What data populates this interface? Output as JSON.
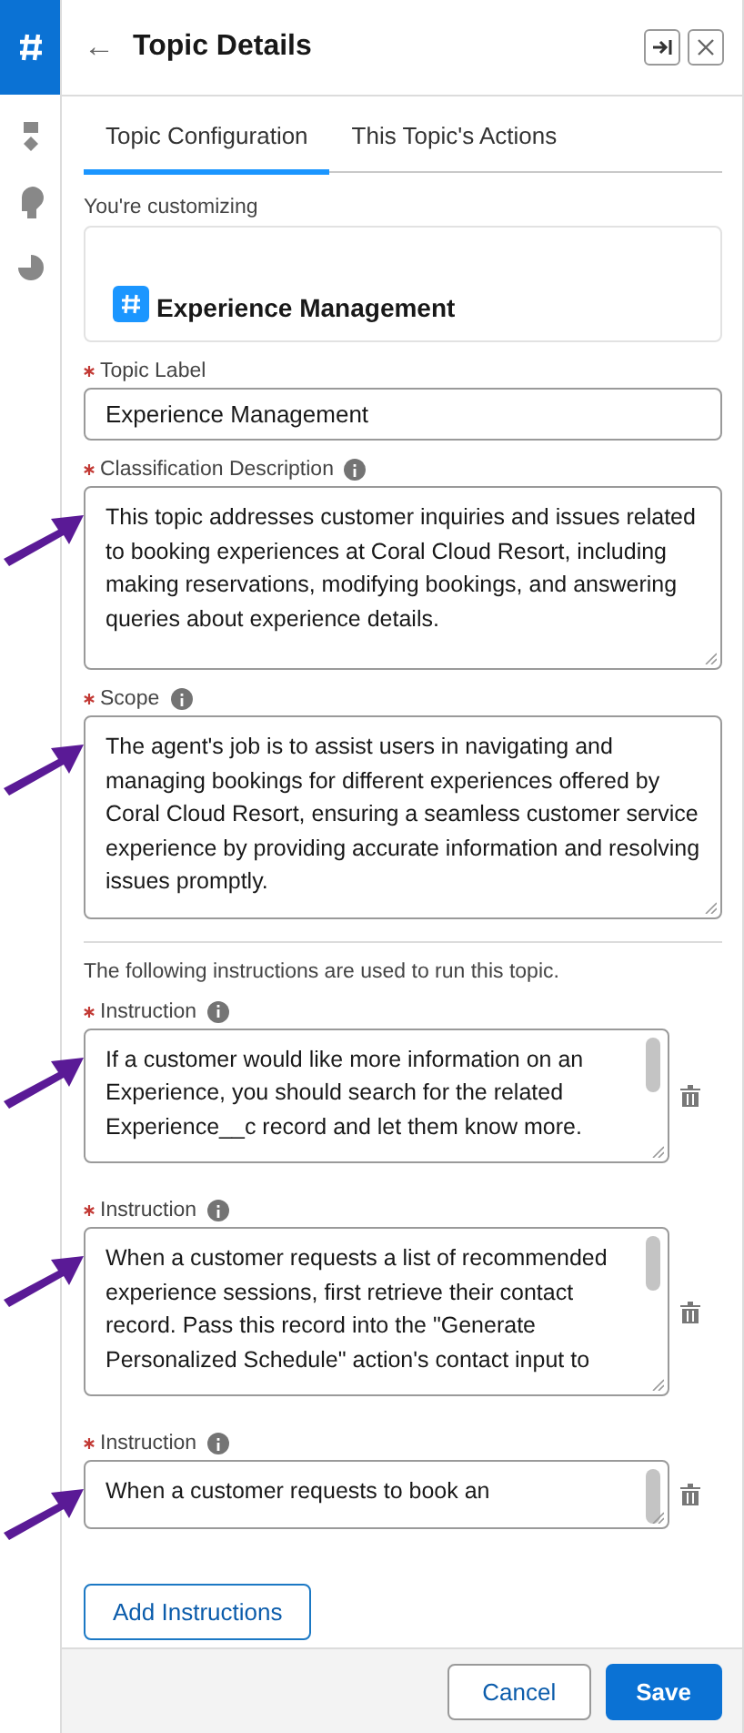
{
  "rail": [
    {
      "selected": true
    },
    {
      "selected": false
    },
    {
      "selected": false
    },
    {
      "selected": false
    }
  ],
  "header": {
    "back": "←",
    "title": "Topic Details"
  },
  "tabs": [
    {
      "label": "Topic Configuration",
      "selected": true
    },
    {
      "label": "This Topic's Actions",
      "selected": false
    }
  ],
  "customizing": {
    "label": "You're customizing",
    "topic": "Experience Management"
  },
  "topic_label": {
    "label": "Topic Label",
    "required": true,
    "value": "Experience Management"
  },
  "classification_description": {
    "label": "Classification Description",
    "required": true,
    "info": true,
    "annotated": true,
    "value": "This topic addresses customer inquiries and issues related to booking experiences at Coral Cloud Resort, including making reservations, modifying bookings, and answering queries about experience details."
  },
  "scope": {
    "label": "Scope",
    "required": true,
    "info": true,
    "annotated": true,
    "value": "The agent's job is to assist users in navigating and managing bookings for different experiences offered by Coral Cloud Resort, ensuring a seamless customer service experience by providing accurate information and resolving issues promptly."
  },
  "instructions_intro": "The following instructions are used to run this topic.",
  "instructions": [
    {
      "label": "Instruction",
      "required": true,
      "info": true,
      "annotated": true,
      "value": "If a customer would like more information on an Experience, you should search for the related Experience__c record and let them know more."
    },
    {
      "label": "Instruction",
      "required": true,
      "info": true,
      "annotated": true,
      "value": "When a customer requests a list of recommended experience sessions, first retrieve their contact record. Pass this record into the \"Generate Personalized Schedule\" action's contact input to"
    },
    {
      "label": "Instruction",
      "required": true,
      "info": true,
      "annotated": true,
      "value": "When a customer requests to book an"
    }
  ],
  "add_button": "Add Instructions",
  "footer": {
    "cancel": "Cancel",
    "save": "Save"
  }
}
